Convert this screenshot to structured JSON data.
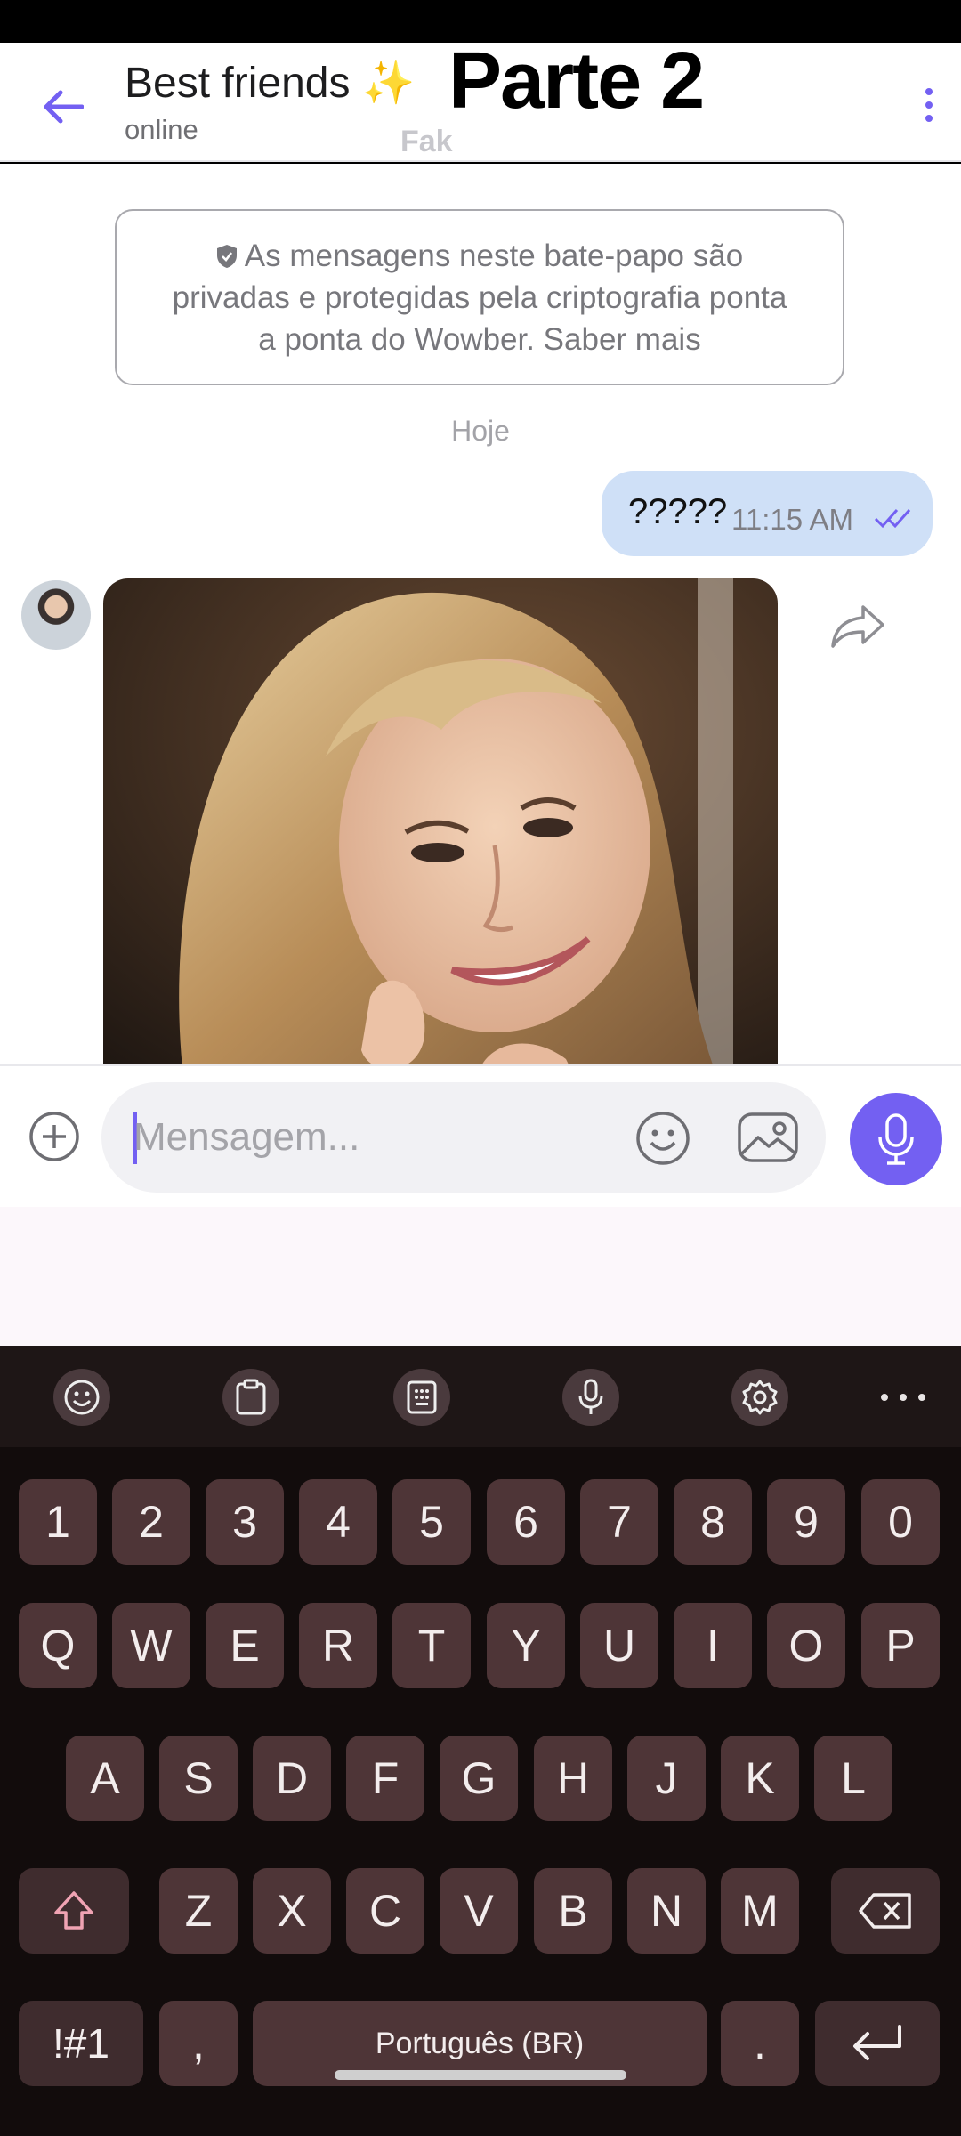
{
  "header": {
    "back_icon": "arrow-left-icon",
    "title": "Best friends ✨",
    "status": "online",
    "ghost_text": "Fak",
    "overlay_caption": "Parte 2",
    "menu_icon": "more-vertical-icon",
    "accent_color": "#7360f2"
  },
  "chat": {
    "e2e_notice": "As mensagens neste bate-papo são privadas e protegidas pela criptografia ponta a ponta do Wowber. Saber mais",
    "date_separator": "Hoje",
    "outgoing_message": {
      "text": "?????",
      "time": "11:15 AM",
      "status_icon": "double-check-icon"
    },
    "incoming_message": {
      "type": "photo",
      "content": "photo of a smiling girl with long blonde hair"
    }
  },
  "composer": {
    "placeholder": "Mensagem...",
    "value": ""
  },
  "keyboard": {
    "toolbar_icons": [
      "emoji-icon",
      "clipboard-icon",
      "keypad-icon",
      "microphone-icon",
      "settings-icon",
      "more-horizontal-icon"
    ],
    "row_numbers": [
      "1",
      "2",
      "3",
      "4",
      "5",
      "6",
      "7",
      "8",
      "9",
      "0"
    ],
    "row_top": [
      "Q",
      "W",
      "E",
      "R",
      "T",
      "Y",
      "U",
      "I",
      "O",
      "P"
    ],
    "row_home": [
      "A",
      "S",
      "D",
      "F",
      "G",
      "H",
      "J",
      "K",
      "L"
    ],
    "row_bottom": [
      "Z",
      "X",
      "C",
      "V",
      "B",
      "N",
      "M"
    ],
    "symbols_key": "!#1",
    "comma_key": ",",
    "space_label": "Português (BR)",
    "period_key": "."
  }
}
